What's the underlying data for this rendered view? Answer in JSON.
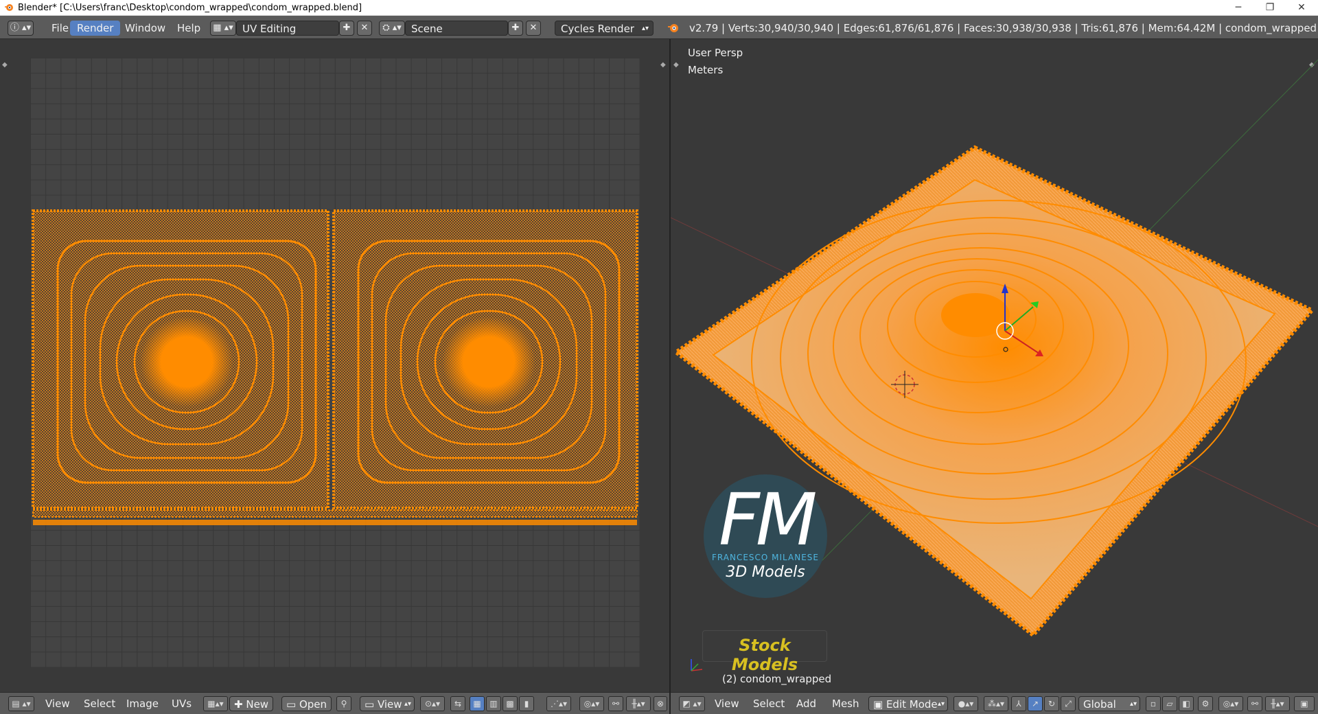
{
  "window": {
    "title": "Blender* [C:\\Users\\franc\\Desktop\\condom_wrapped\\condom_wrapped.blend]",
    "controls": {
      "minimize": "─",
      "restore": "❐",
      "close": "✕"
    }
  },
  "info_header": {
    "menus": [
      "File",
      "Render",
      "Window",
      "Help"
    ],
    "active_menu": "Render",
    "screen_layout": "UV Editing",
    "scene": "Scene",
    "render_engine": "Cycles Render",
    "stats": "v2.79 | Verts:30,940/30,940 | Edges:61,876/61,876 | Faces:30,938/30,938 | Tris:61,876 | Mem:64.42M | condom_wrapped"
  },
  "viewport": {
    "view_name": "User Persp",
    "units": "Meters",
    "object_label": "(2) condom_wrapped"
  },
  "watermark": {
    "letters": "FM",
    "brand": "FRANCESCO MILANESE",
    "tagline": "3D Models",
    "banner": "Stock Models"
  },
  "uv_footer": {
    "menus": [
      "View",
      "Select",
      "Image",
      "UVs"
    ],
    "new_label": "New",
    "open_label": "Open",
    "view_label": "View"
  },
  "vp_footer": {
    "menus": [
      "View",
      "Select",
      "Add",
      "Mesh"
    ],
    "mode": "Edit Mode",
    "orientation": "Global"
  },
  "colors": {
    "accent": "#5680c2",
    "selection": "#ff8c00",
    "header": "#5b5b5b",
    "background": "#393939"
  }
}
